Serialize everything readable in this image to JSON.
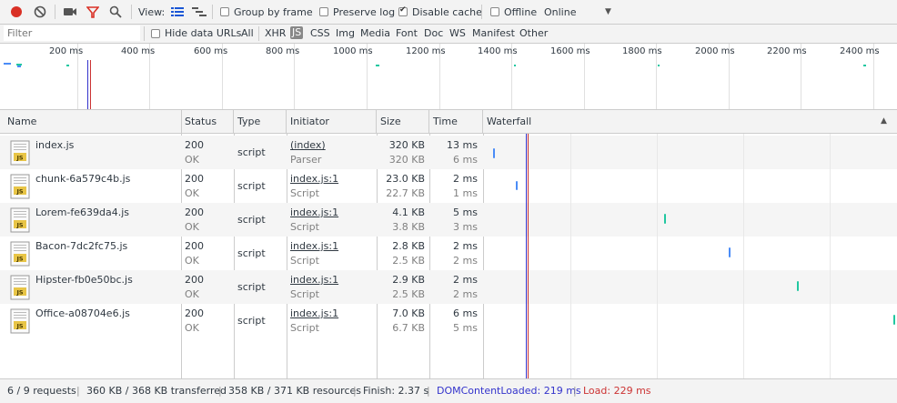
{
  "toolbar": {
    "view_label": "View:",
    "group_by_frame": "Group by frame",
    "preserve_log": "Preserve log",
    "disable_cache": "Disable cache",
    "offline": "Offline",
    "throttle_value": "Online"
  },
  "filterbar": {
    "placeholder": "Filter",
    "hide_data_urls": "Hide data URLs",
    "types": [
      "All",
      "XHR",
      "JS",
      "CSS",
      "Img",
      "Media",
      "Font",
      "Doc",
      "WS",
      "Manifest",
      "Other"
    ],
    "selected_type": "JS"
  },
  "overview": {
    "ticks": [
      "200 ms",
      "400 ms",
      "600 ms",
      "800 ms",
      "1000 ms",
      "1200 ms",
      "1400 ms",
      "1600 ms",
      "1800 ms",
      "2000 ms",
      "2200 ms",
      "2400 ms"
    ]
  },
  "table": {
    "columns": {
      "name": "Name",
      "status": "Status",
      "type": "Type",
      "initiator": "Initiator",
      "size": "Size",
      "time": "Time",
      "waterfall": "Waterfall"
    },
    "rows": [
      {
        "name": "index.js",
        "status": "200",
        "status_text": "OK",
        "type": "script",
        "initiator": "(index)",
        "initiator_sub": "Parser",
        "size": "320 KB",
        "size_sub": "320 KB",
        "time": "13 ms",
        "time_sub": "6 ms"
      },
      {
        "name": "chunk-6a579c4b.js",
        "status": "200",
        "status_text": "OK",
        "type": "script",
        "initiator": "index.js:1",
        "initiator_sub": "Script",
        "size": "23.0 KB",
        "size_sub": "22.7 KB",
        "time": "2 ms",
        "time_sub": "1 ms"
      },
      {
        "name": "Lorem-fe639da4.js",
        "status": "200",
        "status_text": "OK",
        "type": "script",
        "initiator": "index.js:1",
        "initiator_sub": "Script",
        "size": "4.1 KB",
        "size_sub": "3.8 KB",
        "time": "5 ms",
        "time_sub": "3 ms"
      },
      {
        "name": "Bacon-7dc2fc75.js",
        "status": "200",
        "status_text": "OK",
        "type": "script",
        "initiator": "index.js:1",
        "initiator_sub": "Script",
        "size": "2.8 KB",
        "size_sub": "2.5 KB",
        "time": "2 ms",
        "time_sub": "2 ms"
      },
      {
        "name": "Hipster-fb0e50bc.js",
        "status": "200",
        "status_text": "OK",
        "type": "script",
        "initiator": "index.js:1",
        "initiator_sub": "Script",
        "size": "2.9 KB",
        "size_sub": "2.5 KB",
        "time": "2 ms",
        "time_sub": "2 ms"
      },
      {
        "name": "Office-a08704e6.js",
        "status": "200",
        "status_text": "OK",
        "type": "script",
        "initiator": "index.js:1",
        "initiator_sub": "Script",
        "size": "7.0 KB",
        "size_sub": "6.7 KB",
        "time": "6 ms",
        "time_sub": "5 ms"
      }
    ]
  },
  "statusbar": {
    "requests": "6 / 9 requests",
    "transferred": "360 KB / 368 KB transferred",
    "resources": "358 KB / 371 KB resources",
    "finish": "Finish: 2.37 s",
    "dom_content_loaded": "DOMContentLoaded: 219 ms",
    "load": "Load: 229 ms",
    "separator": "|"
  },
  "colors": {
    "record": "#d93025",
    "filter_active": "#d93025",
    "dom_content_loaded": "#3333cc",
    "load": "#cc3333",
    "bar_blue": "#4a8cf7",
    "bar_teal": "#21c7a0"
  }
}
